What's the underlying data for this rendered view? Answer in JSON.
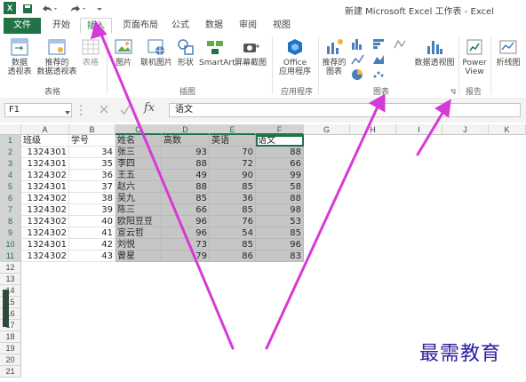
{
  "window": {
    "title": "新建 Microsoft Excel 工作表 - Excel",
    "logo": "X"
  },
  "quick_access": {
    "save_icon": "save-icon",
    "undo_icon": "undo-icon",
    "redo_icon": "redo-icon"
  },
  "tabs": [
    "文件",
    "开始",
    "插入",
    "页面布局",
    "公式",
    "数据",
    "审阅",
    "视图"
  ],
  "active_tab": "插入",
  "ribbon": {
    "groups": [
      {
        "label": "表格",
        "buttons": [
          "数据\n透视表",
          "推荐的\n数据透视表",
          "表格"
        ]
      },
      {
        "label": "插图",
        "buttons": [
          "图片",
          "联机图片",
          "形状",
          "SmartArt",
          "屏幕截图"
        ]
      },
      {
        "label": "应用程序",
        "buttons": [
          "Office\n应用程序"
        ]
      },
      {
        "label": "图表",
        "buttons": [
          "推荐的\n图表",
          "数据透视图"
        ]
      },
      {
        "label": "报告",
        "buttons": [
          "Power\nView"
        ]
      },
      {
        "label": "",
        "buttons": [
          "折线图"
        ]
      }
    ]
  },
  "formula_bar": {
    "name_box": "F1",
    "fx": "fx",
    "value": "语文"
  },
  "columns": [
    "A",
    "B",
    "C",
    "D",
    "E",
    "F",
    "G",
    "H",
    "I",
    "J",
    "K"
  ],
  "row_numbers": [
    "1",
    "2",
    "3",
    "4",
    "5",
    "6",
    "7",
    "8",
    "9",
    "10",
    "11",
    "12",
    "13",
    "14",
    "15",
    "16",
    "17",
    "18",
    "19",
    "20",
    "21"
  ],
  "headers": [
    "班级",
    "学号",
    "姓名",
    "高数",
    "英语",
    "语文"
  ],
  "rows": [
    [
      "1324301",
      "34",
      "张三",
      "93",
      "70",
      "88"
    ],
    [
      "1324301",
      "35",
      "李四",
      "88",
      "72",
      "66"
    ],
    [
      "1324302",
      "36",
      "王五",
      "49",
      "90",
      "99"
    ],
    [
      "1324301",
      "37",
      "赵六",
      "88",
      "85",
      "58"
    ],
    [
      "1324302",
      "38",
      "吴九",
      "85",
      "36",
      "88"
    ],
    [
      "1324302",
      "39",
      "陈三",
      "66",
      "85",
      "98"
    ],
    [
      "1324302",
      "40",
      "欧阳豆豆",
      "96",
      "76",
      "53"
    ],
    [
      "1324302",
      "41",
      "宣云哲",
      "96",
      "54",
      "85"
    ],
    [
      "1324301",
      "42",
      "刘悦",
      "73",
      "85",
      "96"
    ],
    [
      "1324302",
      "43",
      "曾星",
      "79",
      "86",
      "83"
    ]
  ],
  "watermark": "最需教育",
  "accent": "#217346",
  "arrow_color": "#d63ad6"
}
